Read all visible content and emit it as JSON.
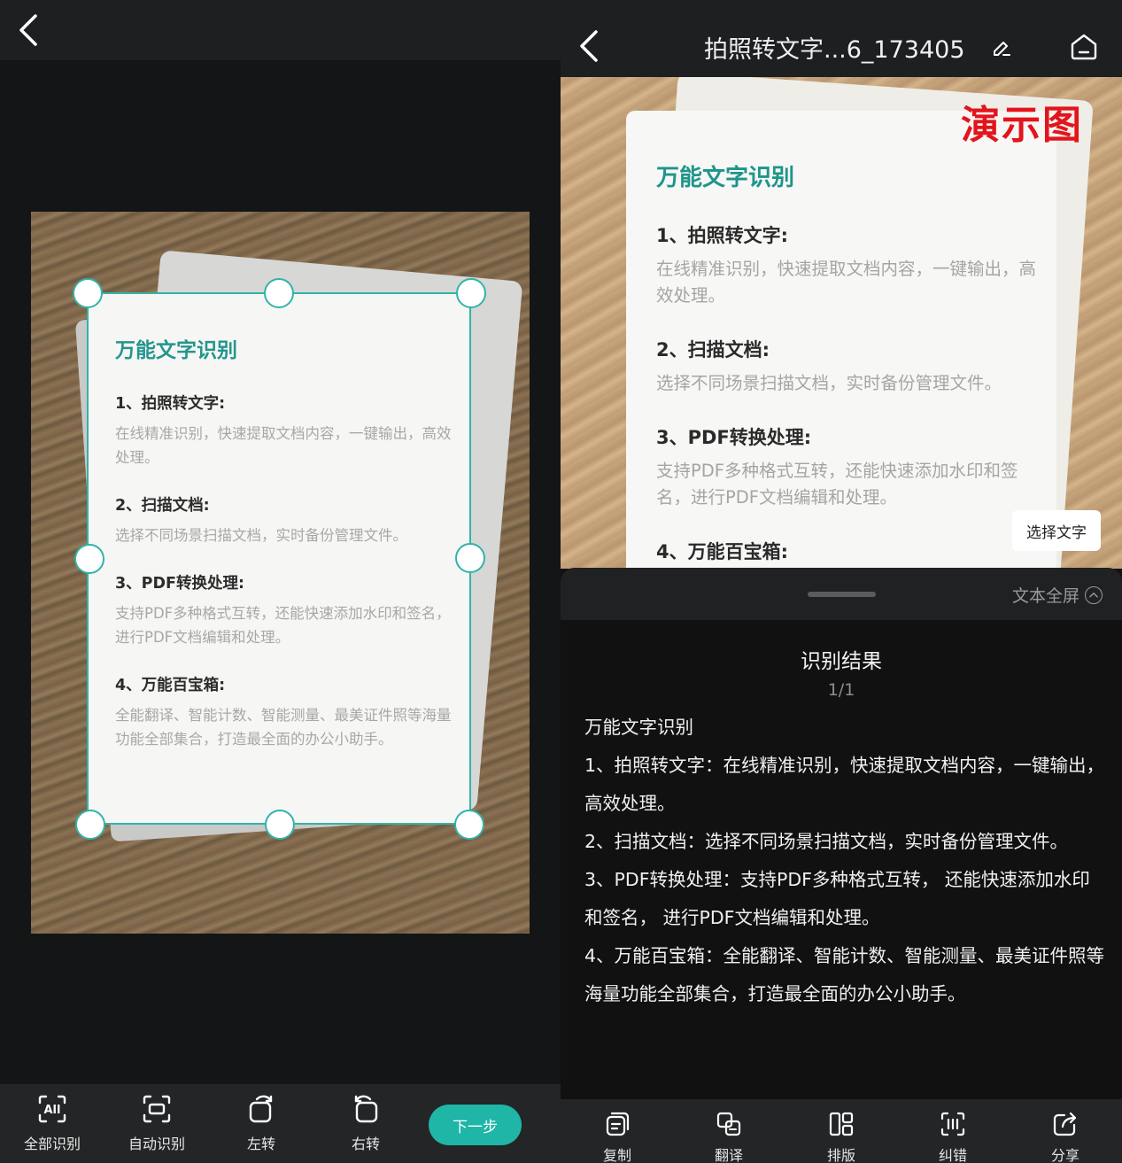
{
  "left": {
    "document": {
      "title": "万能文字识别",
      "h1": "1、拍照转文字:",
      "b1": "在线精准识别，快速提取文档内容，一键输出，高效处理。",
      "h2": "2、扫描文档:",
      "b2": "选择不同场景扫描文档，实时备份管理文件。",
      "h3": "3、PDF转换处理:",
      "b3": "支持PDF多种格式互转，还能快速添加水印和签名，进行PDF文档编辑和处理。",
      "h4": "4、万能百宝箱:",
      "b4": "全能翻译、智能计数、智能测量、最美证件照等海量功能全部集合，打造最全面的办公小助手。"
    },
    "toolbar": {
      "recognize_all": "全部识别",
      "auto_recognize": "自动识别",
      "rotate_left": "左转",
      "rotate_right": "右转",
      "next": "下一步"
    }
  },
  "right": {
    "header": {
      "title": "拍照转文字...6_173405"
    },
    "preview": {
      "watermark": "演示图",
      "title": "万能文字识别",
      "h1": "1、拍照转文字:",
      "b1": "在线精准识别，快速提取文档内容，一键输出，高效处理。",
      "h2": "2、扫描文档:",
      "b2": "选择不同场景扫描文档，实时备份管理文件。",
      "h3": "3、PDF转换处理:",
      "b3": "支持PDF多种格式互转，还能快速添加水印和签名，进行PDF文档编辑和处理。",
      "h4": "4、万能百宝箱:",
      "select_text": "选择文字"
    },
    "sheet": {
      "fullscreen": "文本全屏",
      "result_title": "识别结果",
      "page": "1/1",
      "lines": [
        "万能文字识别",
        "1、拍照转文字：在线精准识别，快速提取文档内容，一键输出，高效处理。",
        "2、扫描文档：选择不同场景扫描文档，实时备份管理文件。",
        "3、PDF转换处理：支持PDF多种格式互转， 还能快速添加水印和签名， 进行PDF文档编辑和处理。",
        "4、万能百宝箱：全能翻译、智能计数、智能测量、最美证件照等海量功能全部集合，打造最全面的办公小助手。"
      ]
    },
    "toolbar": {
      "copy": "复制",
      "translate": "翻译",
      "layout": "排版",
      "correct": "纠错",
      "share": "分享"
    }
  },
  "colors": {
    "accent": "#1fb5a7",
    "crop_border": "#33b3a8",
    "watermark": "#e3141c"
  }
}
